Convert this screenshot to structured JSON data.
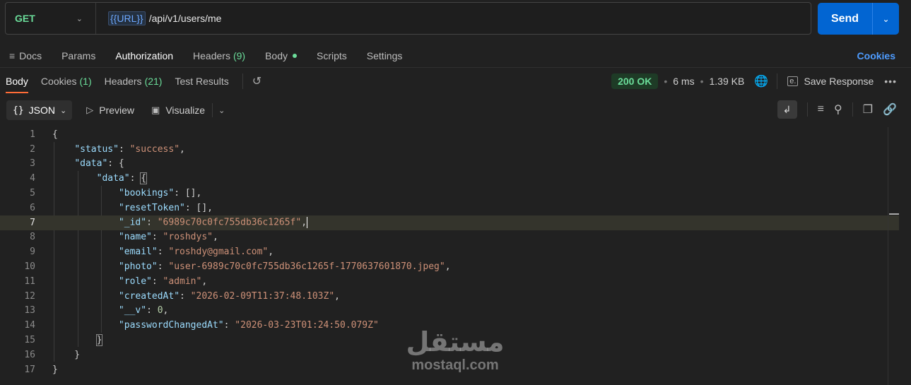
{
  "request": {
    "method": "GET",
    "url_variable": "{{URL}}",
    "url_path": "/api/v1/users/me",
    "send_label": "Send"
  },
  "request_tabs": [
    {
      "label": "Docs"
    },
    {
      "label": "Params"
    },
    {
      "label": "Authorization"
    },
    {
      "label": "Headers",
      "count": "(9)"
    },
    {
      "label": "Body"
    },
    {
      "label": "Scripts"
    },
    {
      "label": "Settings"
    }
  ],
  "cookies_link": "Cookies",
  "response_tabs": [
    {
      "label": "Body"
    },
    {
      "label": "Cookies",
      "count": "(1)"
    },
    {
      "label": "Headers",
      "count": "(21)"
    },
    {
      "label": "Test Results"
    }
  ],
  "response_meta": {
    "status": "200 OK",
    "time": "6 ms",
    "size": "1.39 KB",
    "save_label": "Save Response"
  },
  "toolbar": {
    "format": "JSON",
    "preview": "Preview",
    "visualize": "Visualize"
  },
  "line_numbers": [
    "1",
    "2",
    "3",
    "4",
    "5",
    "6",
    "7",
    "8",
    "9",
    "10",
    "11",
    "12",
    "13",
    "14",
    "15",
    "16",
    "17"
  ],
  "json": {
    "status_key": "\"status\"",
    "status_val": "\"success\"",
    "data_key": "\"data\"",
    "inner_data_key": "\"data\"",
    "bookings_key": "\"bookings\"",
    "resetToken_key": "\"resetToken\"",
    "id_key": "\"_id\"",
    "id_val": "\"6989c70c0fc755db36c1265f\"",
    "name_key": "\"name\"",
    "name_val": "\"roshdys\"",
    "email_key": "\"email\"",
    "email_val": "\"roshdy@gmail.com\"",
    "photo_key": "\"photo\"",
    "photo_val": "\"user-6989c70c0fc755db36c1265f-1770637601870.jpeg\"",
    "role_key": "\"role\"",
    "role_val": "\"admin\"",
    "createdAt_key": "\"createdAt\"",
    "createdAt_val": "\"2026-02-09T11:37:48.103Z\"",
    "v_key": "\"__v\"",
    "v_val": "0",
    "passwordChangedAt_key": "\"passwordChangedAt\"",
    "passwordChangedAt_val": "\"2026-03-23T01:24:50.079Z\""
  },
  "watermark": {
    "arabic": "مستقل",
    "latin": "mostaql.com"
  }
}
